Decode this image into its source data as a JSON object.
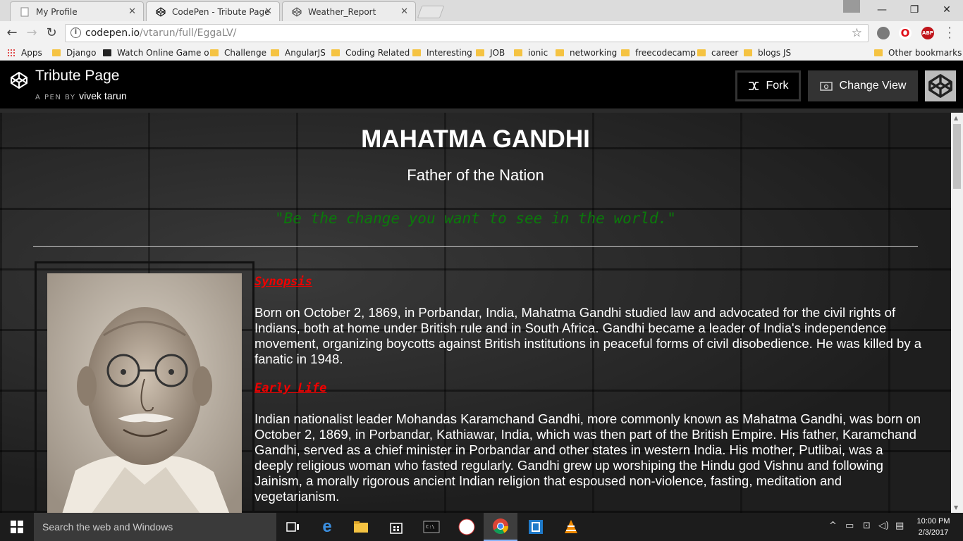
{
  "browser": {
    "tabs": [
      {
        "label": "My Profile",
        "active": false
      },
      {
        "label": "CodePen - Tribute Page",
        "active": true
      },
      {
        "label": "Weather_Report",
        "active": false
      }
    ],
    "url_host": "codepen.io",
    "url_path": "/vtarun/full/EggaLV/",
    "window_controls": {
      "minimize": "—",
      "restore": "❐",
      "close": "✕"
    },
    "extensions": [
      {
        "name": "extension-icon",
        "color": "#7a7a7a"
      },
      {
        "name": "opera-icon",
        "label": "O",
        "color": "#e0101a"
      },
      {
        "name": "adblock-icon",
        "label": "ABP",
        "color": "#c0141a"
      }
    ]
  },
  "bookmarks": {
    "apps_label": "Apps",
    "items": [
      "Django",
      "Watch Online Game o",
      "Challenge",
      "AngularJS",
      "Coding Related",
      "Interesting",
      "JOB",
      "ionic",
      "networking",
      "freecodecamp",
      "career",
      "blogs JS"
    ],
    "other_label": "Other bookmarks"
  },
  "codepen": {
    "title": "Tribute Page",
    "by_prefix": "A PEN BY",
    "author": "vivek tarun",
    "fork_label": "Fork",
    "change_view_label": "Change View"
  },
  "page": {
    "heading": "MAHATMA GANDHI",
    "subtitle": "Father of the Nation",
    "quote": "\"Be the change you want to see in the world.\"",
    "sections": [
      {
        "heading": "Synopsis",
        "body": "Born on October 2, 1869, in Porbandar, India, Mahatma Gandhi studied law and advocated for the civil rights of Indians, both at home under British rule and in South Africa. Gandhi became a leader of India's independence movement, organizing boycotts against British institutions in peaceful forms of civil disobedience. He was killed by a fanatic in 1948."
      },
      {
        "heading": "Early Life",
        "body": "Indian nationalist leader Mohandas Karamchand Gandhi, more commonly known as Mahatma Gandhi, was born on October 2, 1869, in Porbandar, Kathiawar, India, which was then part of the British Empire. His father, Karamchand Gandhi, served as a chief minister in Porbandar and other states in western India. His mother, Putlibai, was a deeply religious woman who fasted regularly. Gandhi grew up worshiping the Hindu god Vishnu and following Jainism, a morally rigorous ancient Indian religion that espoused non-violence, fasting, meditation and vegetarianism."
      }
    ],
    "colors": {
      "quote": "#0a7a0a",
      "section_heading": "#e00000",
      "text": "#ffffff"
    }
  },
  "taskbar": {
    "search_placeholder": "Search the web and Windows",
    "time": "10:00 PM",
    "date": "2/3/2017"
  }
}
